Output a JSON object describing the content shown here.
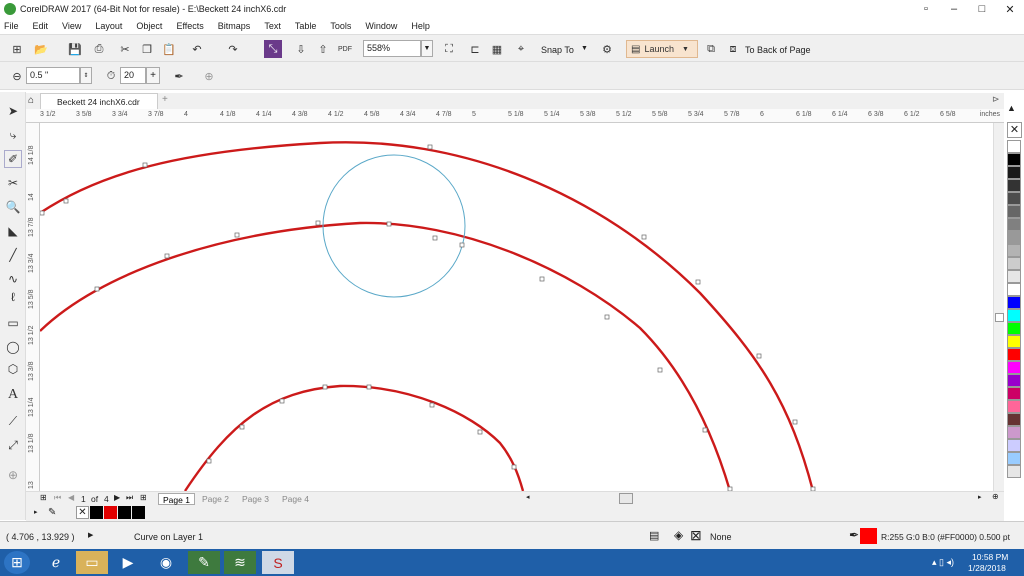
{
  "window": {
    "title": "CorelDRAW 2017 (64-Bit Not for resale) - E:\\Beckett 24 inchX6.cdr"
  },
  "menu": [
    "File",
    "Edit",
    "View",
    "Layout",
    "Object",
    "Effects",
    "Bitmaps",
    "Text",
    "Table",
    "Tools",
    "Window",
    "Help"
  ],
  "toolbar": {
    "zoom": "558%",
    "snap_label": "Snap To",
    "launch_label": "Launch",
    "to_back_label": "To Back of Page",
    "pdf_label": "PDF"
  },
  "propbar": {
    "outline_width": "0.5 \"",
    "angle_value": "20"
  },
  "document": {
    "tab_label": "Beckett 24 inchX6.cdr"
  },
  "ruler": {
    "h_ticks": [
      "3 1/2",
      "3 5/8",
      "3 3/4",
      "3 7/8",
      "4",
      "4 1/8",
      "4 1/4",
      "4 3/8",
      "4 1/2",
      "4 5/8",
      "4 3/4",
      "4 7/8",
      "5",
      "5 1/8",
      "5 1/4",
      "5 3/8",
      "5 1/2",
      "5 5/8",
      "5 3/4",
      "5 7/8",
      "6",
      "6 1/8",
      "6 1/4",
      "6 3/8",
      "6 1/2",
      "6 5/8"
    ],
    "units": "inches",
    "v_ticks": [
      "14 1/8",
      "14",
      "13 7/8",
      "13 3/4",
      "13 5/8",
      "13 1/2",
      "13 3/8",
      "13 1/4",
      "13 1/8",
      "13"
    ]
  },
  "pages": {
    "current": "1",
    "of_label": "of",
    "total": "4",
    "tabs": [
      "Page 1",
      "Page 2",
      "Page 3",
      "Page 4"
    ]
  },
  "status": {
    "coords": "( 4.706 , 13.929 )",
    "object_info": "Curve on Layer 1",
    "fill_label": "None",
    "outline_info": "R:255 G:0 B:0 (#FF0000)  0.500 pt"
  },
  "taskbar": {
    "time": "10:58 PM",
    "date": "1/28/2018"
  },
  "colors": {
    "curve": "#cc1a1a",
    "circle": "#5aa8c8",
    "outline_swatch": "#ff0000",
    "taskbar": "#1f5fa8"
  },
  "palette": [
    "#ffffff",
    "#000000",
    "#1a1a1a",
    "#333333",
    "#4d4d4d",
    "#666666",
    "#808080",
    "#999999",
    "#b3b3b3",
    "#cccccc",
    "#e6e6e6",
    "#ffffff",
    "#0000ff",
    "#00ffff",
    "#00ff00",
    "#ffff00",
    "#ff0000",
    "#ff00ff",
    "#9900cc",
    "#cc0066",
    "#ff6699",
    "#663333",
    "#cc99cc",
    "#ccccff",
    "#99ccff",
    "#e6e6e6"
  ]
}
